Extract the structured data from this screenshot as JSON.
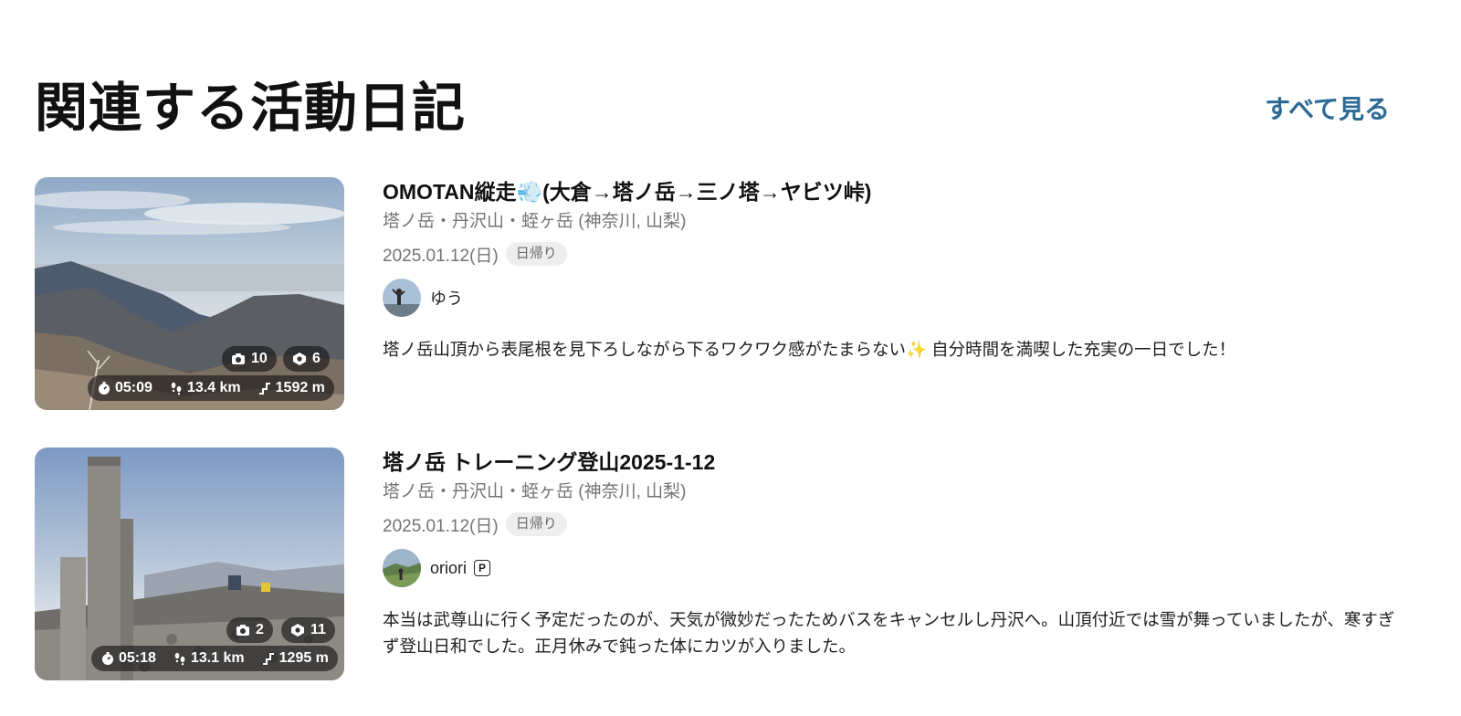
{
  "section": {
    "title": "関連する活動日記",
    "see_all_label": "すべて見る"
  },
  "activities": [
    {
      "title": "OMOTAN縦走💨(大倉→塔ノ岳→三ノ塔→ヤビツ峠)",
      "area": "塔ノ岳・丹沢山・蛭ヶ岳 (神奈川, 山梨)",
      "date": "2025.01.12(日)",
      "badge": "日帰り",
      "user": {
        "name": "ゆう",
        "premium": false
      },
      "description": "塔ノ岳山頂から表尾根を見下ろしながら下るワクワク感がたまらない✨ 自分時間を満喫した充実の一日でした！",
      "stats": {
        "photos": "10",
        "checkpoints": "6",
        "time": "05:09",
        "distance": "13.4 km",
        "elevation": "1592 m"
      }
    },
    {
      "title": "塔ノ岳 トレーニング登山2025-1-12",
      "area": "塔ノ岳・丹沢山・蛭ヶ岳 (神奈川, 山梨)",
      "date": "2025.01.12(日)",
      "badge": "日帰り",
      "user": {
        "name": "oriori",
        "premium": true,
        "premium_label": "P"
      },
      "description": "本当は武尊山に行く予定だったのが、天気が微妙だったためバスをキャンセルし丹沢へ。山頂付近では雪が舞っていましたが、寒すぎず登山日和でした。正月休みで鈍った体にカツが入りました。",
      "stats": {
        "photos": "2",
        "checkpoints": "11",
        "time": "05:18",
        "distance": "13.1 km",
        "elevation": "1295 m"
      }
    }
  ],
  "icons": {
    "camera": "camera-icon",
    "checkpoint": "checkpoint-icon",
    "time": "stopwatch-icon",
    "distance": "footprints-icon",
    "elevation": "elevation-icon"
  },
  "colors": {
    "link": "#2d6a96",
    "pill_bg": "#141414",
    "badge_bg": "#eeeeee"
  }
}
